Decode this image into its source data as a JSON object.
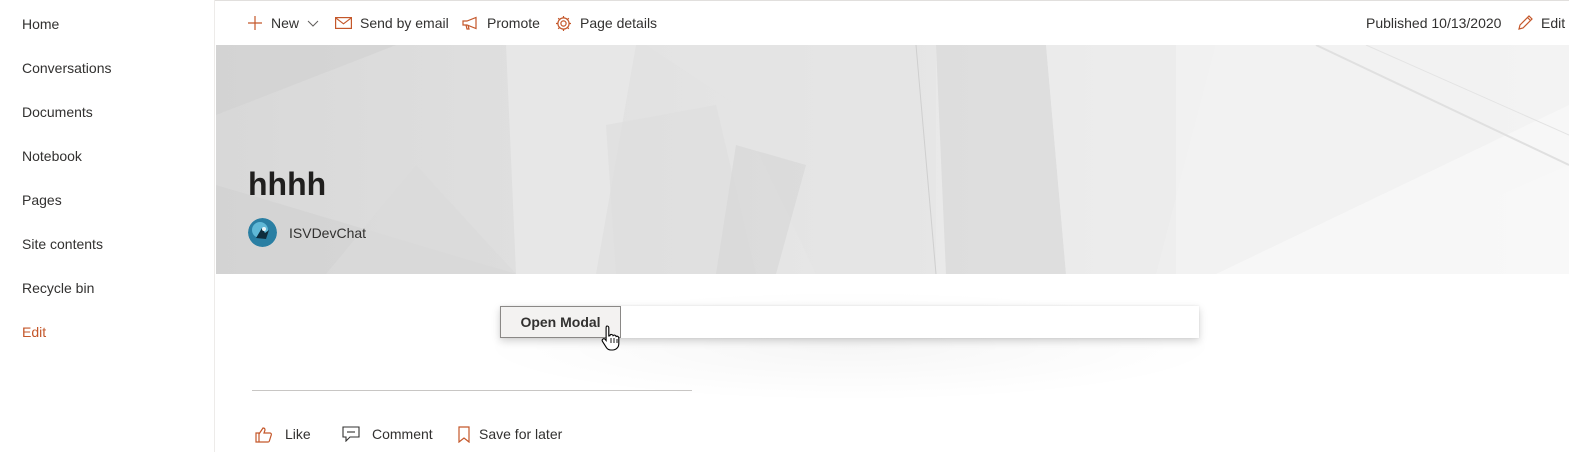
{
  "sidebar": {
    "items": [
      {
        "label": "Home"
      },
      {
        "label": "Conversations"
      },
      {
        "label": "Documents"
      },
      {
        "label": "Notebook"
      },
      {
        "label": "Pages"
      },
      {
        "label": "Site contents"
      },
      {
        "label": "Recycle bin"
      },
      {
        "label": "Edit"
      }
    ]
  },
  "commandbar": {
    "new_label": "New",
    "send_label": "Send by email",
    "promote_label": "Promote",
    "details_label": "Page details",
    "published_label": "Published 10/13/2020",
    "edit_label": "Edit"
  },
  "page": {
    "title": "hhhh",
    "author": "ISVDevChat"
  },
  "webpart": {
    "button_label": "Open Modal"
  },
  "social": {
    "like_label": "Like",
    "comment_label": "Comment",
    "save_label": "Save for later"
  },
  "colors": {
    "accent": "#c4572a",
    "text": "#323130"
  },
  "icons": {
    "new": "plus-icon",
    "new_menu": "chevron-down-icon",
    "send": "mail-icon",
    "promote": "megaphone-icon",
    "details": "gear-icon",
    "edit": "pencil-icon",
    "like": "thumbs-up-icon",
    "comment": "comment-icon",
    "save": "bookmark-icon"
  }
}
